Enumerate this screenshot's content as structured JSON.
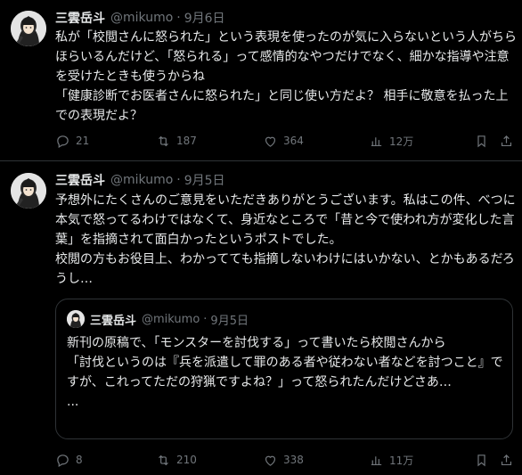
{
  "tweets": [
    {
      "author": {
        "name": "三雲岳斗",
        "handle": "@mikumo",
        "date": "9月6日"
      },
      "text": "私が「校閲さんに怒られた」という表現を使ったのが気に入らないという人がちらほらいるんだけど、「怒られる」って感情的なやつだけでなく、細かな指導や注意を受けたときも使うからね\n「健康診断でお医者さんに怒られた」と同じ使い方だよ？ 相手に敬意を払った上での表現だよ？",
      "stats": {
        "replies": "21",
        "retweets": "187",
        "likes": "364",
        "views": "12万"
      }
    },
    {
      "author": {
        "name": "三雲岳斗",
        "handle": "@mikumo",
        "date": "9月5日"
      },
      "text": "予想外にたくさんのご意見をいただきありがとうございます。私はこの件、べつに本気で怒ってるわけではなくて、身近なところで「昔と今で使われ方が変化した言葉」を指摘されて面白かったというポストでした。\n校閲の方もお役目上、わかってても指摘しないわけにはいかない、とかもあるだろうし…",
      "quote": {
        "author": {
          "name": "三雲岳斗",
          "handle": "@mikumo",
          "date": "9月5日"
        },
        "text": "新刊の原稿で、「モンスターを討伐する」って書いたら校閲さんから\n「討伐というのは『兵を派遣して罪のある者や従わない者などを討つこと』ですが、これってただの狩猟ですよね？」って怒られたんだけどさあ…\n..."
      },
      "stats": {
        "replies": "8",
        "retweets": "210",
        "likes": "338",
        "views": "11万"
      }
    }
  ],
  "separator": "·",
  "more_label": "···",
  "colors": {
    "background": "#000000",
    "text": "#e7e9ea",
    "muted": "#71767b",
    "border": "#2f3336"
  },
  "icons": [
    "avatar",
    "more-icon",
    "reply-icon",
    "retweet-icon",
    "like-icon",
    "views-icon",
    "bookmark-icon",
    "share-icon"
  ]
}
